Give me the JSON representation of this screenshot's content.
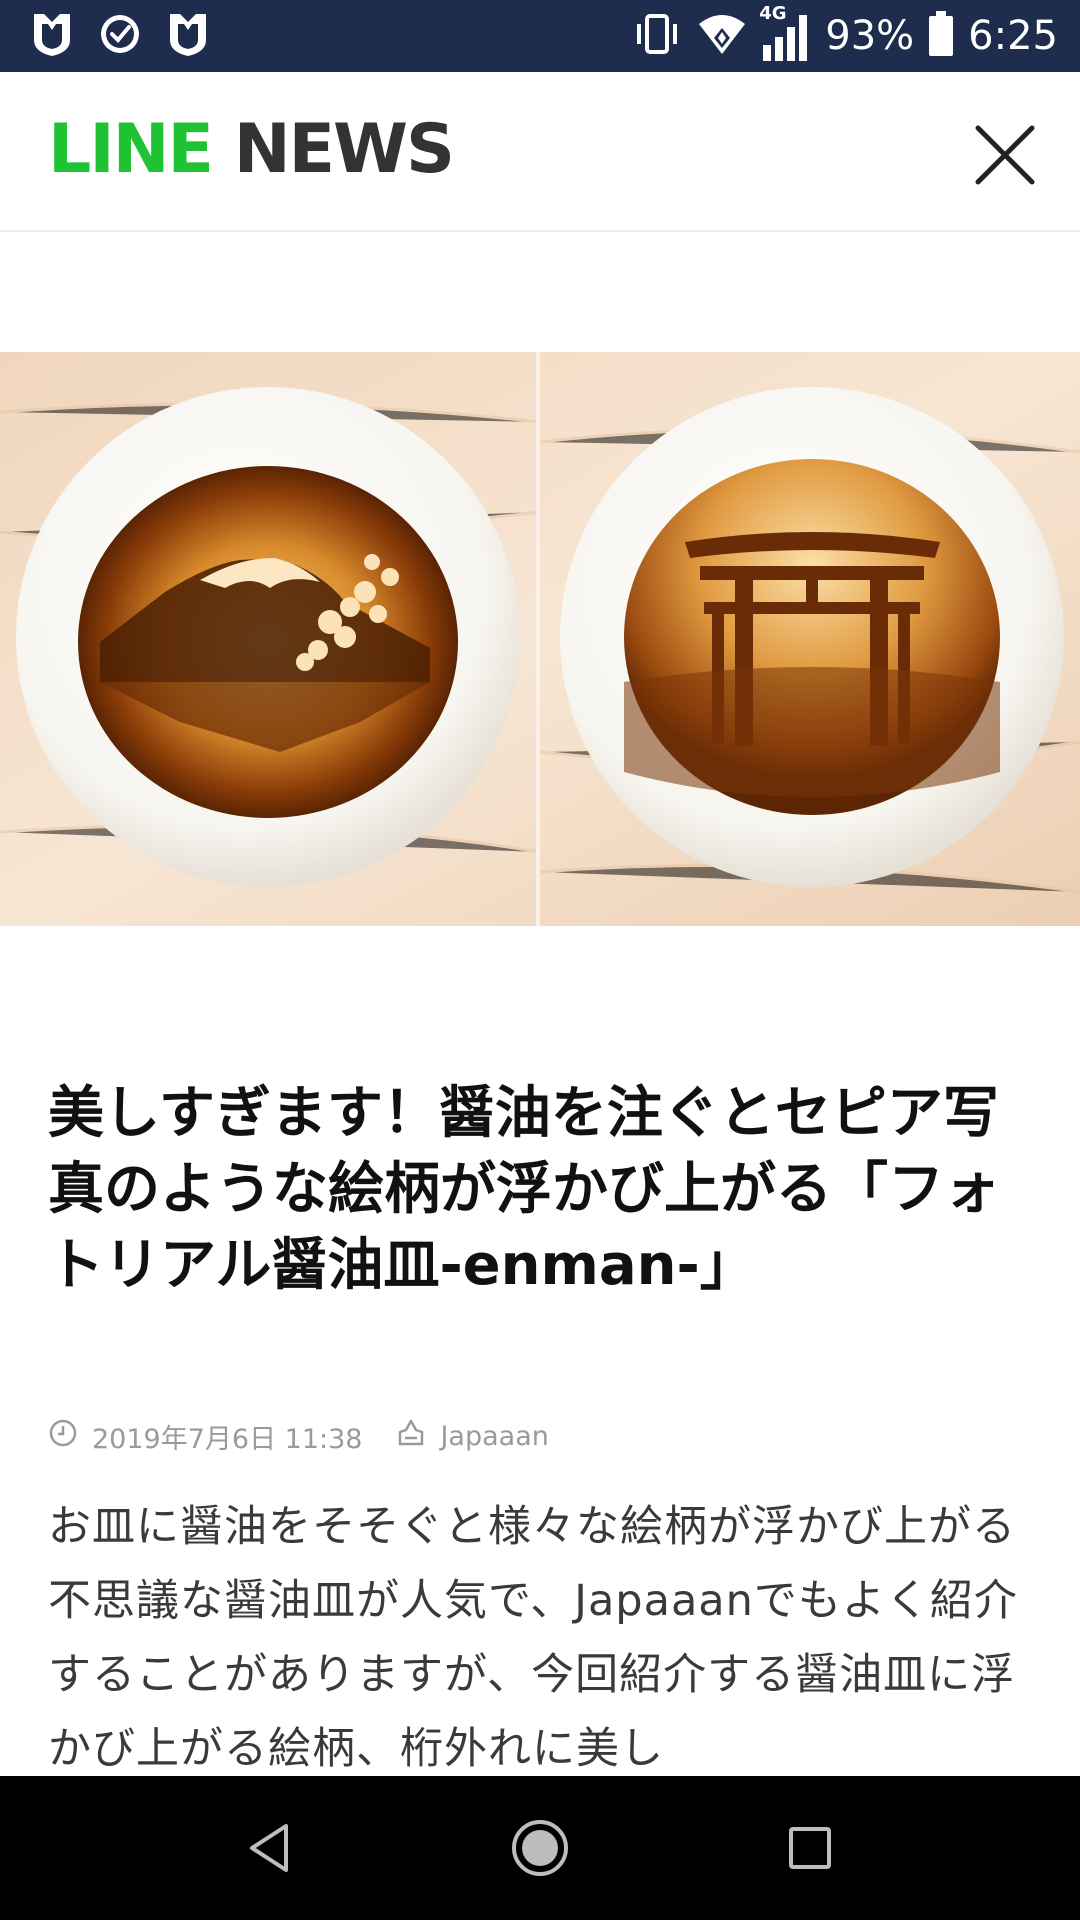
{
  "status_bar": {
    "network_label": "4G",
    "battery": "93%",
    "time": "6:25",
    "left_icons": [
      "shield-icon",
      "check-circle-icon",
      "shield-icon"
    ],
    "right_icons": [
      "vibrate-icon",
      "wifi-icon",
      "signal-icon",
      "battery-icon"
    ]
  },
  "header": {
    "logo_line": "LINE",
    "logo_news": "NEWS",
    "logo_color_line": "#1fc232",
    "logo_color_news": "#333333",
    "close_icon": "close-icon"
  },
  "article": {
    "hero_image": "two soy sauce dishes: Mt. Fuji with cherry blossoms, and a torii gate",
    "title": "美しすぎます！醤油を注ぐとセピア写真のような絵柄が浮かび上がる「フォトリアル醤油皿-enman-」",
    "date": "2019年7月6日 11:38",
    "source": "Japaaan",
    "body": "お皿に醤油をそそぐと様々な絵柄が浮かび上がる不思議な醤油皿が人気で、Japaaanでもよく紹介することがありますが、今回紹介する醤油皿に浮かび上がる絵柄、桁外れに美し"
  },
  "nav_bar": {
    "buttons": [
      "back-icon",
      "home-icon",
      "recents-icon"
    ]
  }
}
